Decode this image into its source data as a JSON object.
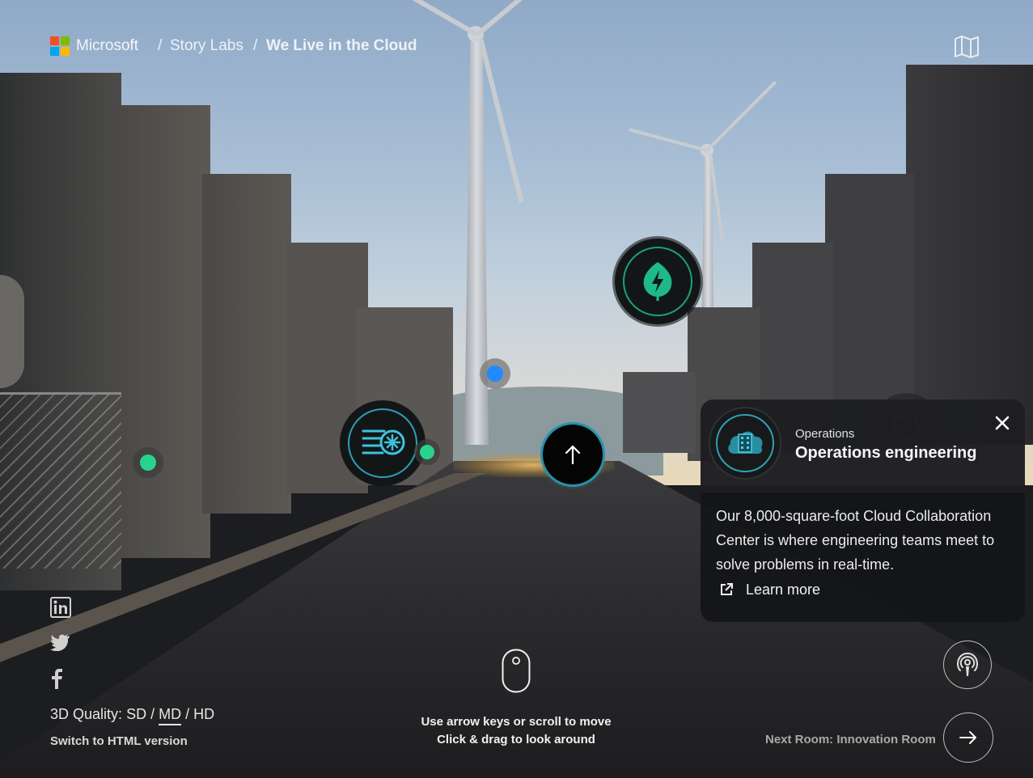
{
  "header": {
    "brand": "Microsoft",
    "sep": "/",
    "breadcrumb_section": "Story Labs",
    "breadcrumb_current": "We Live in the Cloud",
    "map_icon": "map-icon",
    "logo_colors": [
      "#f25022",
      "#7fba00",
      "#00a4ef",
      "#ffb900"
    ]
  },
  "hotspots": {
    "energy_icon": "leaf-lightning-icon",
    "cooling_icon": "server-cooling-icon",
    "move_icon": "arrow-up-icon",
    "accent_green": "#28d48d",
    "accent_blue": "#1f8bff",
    "accent_teal": "#2fa0b5"
  },
  "card": {
    "icon": "cloud-building-icon",
    "category": "Operations",
    "title": "Operations engineering",
    "body": "Our 8,000-square-foot Cloud Collaboration Center is where engineering teams meet to solve problems in real-time.",
    "link": "Learn more",
    "close_icon": "close-icon",
    "link_icon": "external-link-icon"
  },
  "social": {
    "linkedin": "linkedin-icon",
    "twitter": "twitter-icon",
    "facebook": "facebook-icon"
  },
  "quality": {
    "label": "3D Quality:",
    "options": [
      "SD",
      "MD",
      "HD"
    ],
    "selected": "MD",
    "sep": "/"
  },
  "html_link": "Switch to HTML version",
  "hint": {
    "line1": "Use arrow keys or scroll to move",
    "line2": "Click & drag to look around"
  },
  "next": {
    "label": "Next Room: Innovation Room"
  }
}
